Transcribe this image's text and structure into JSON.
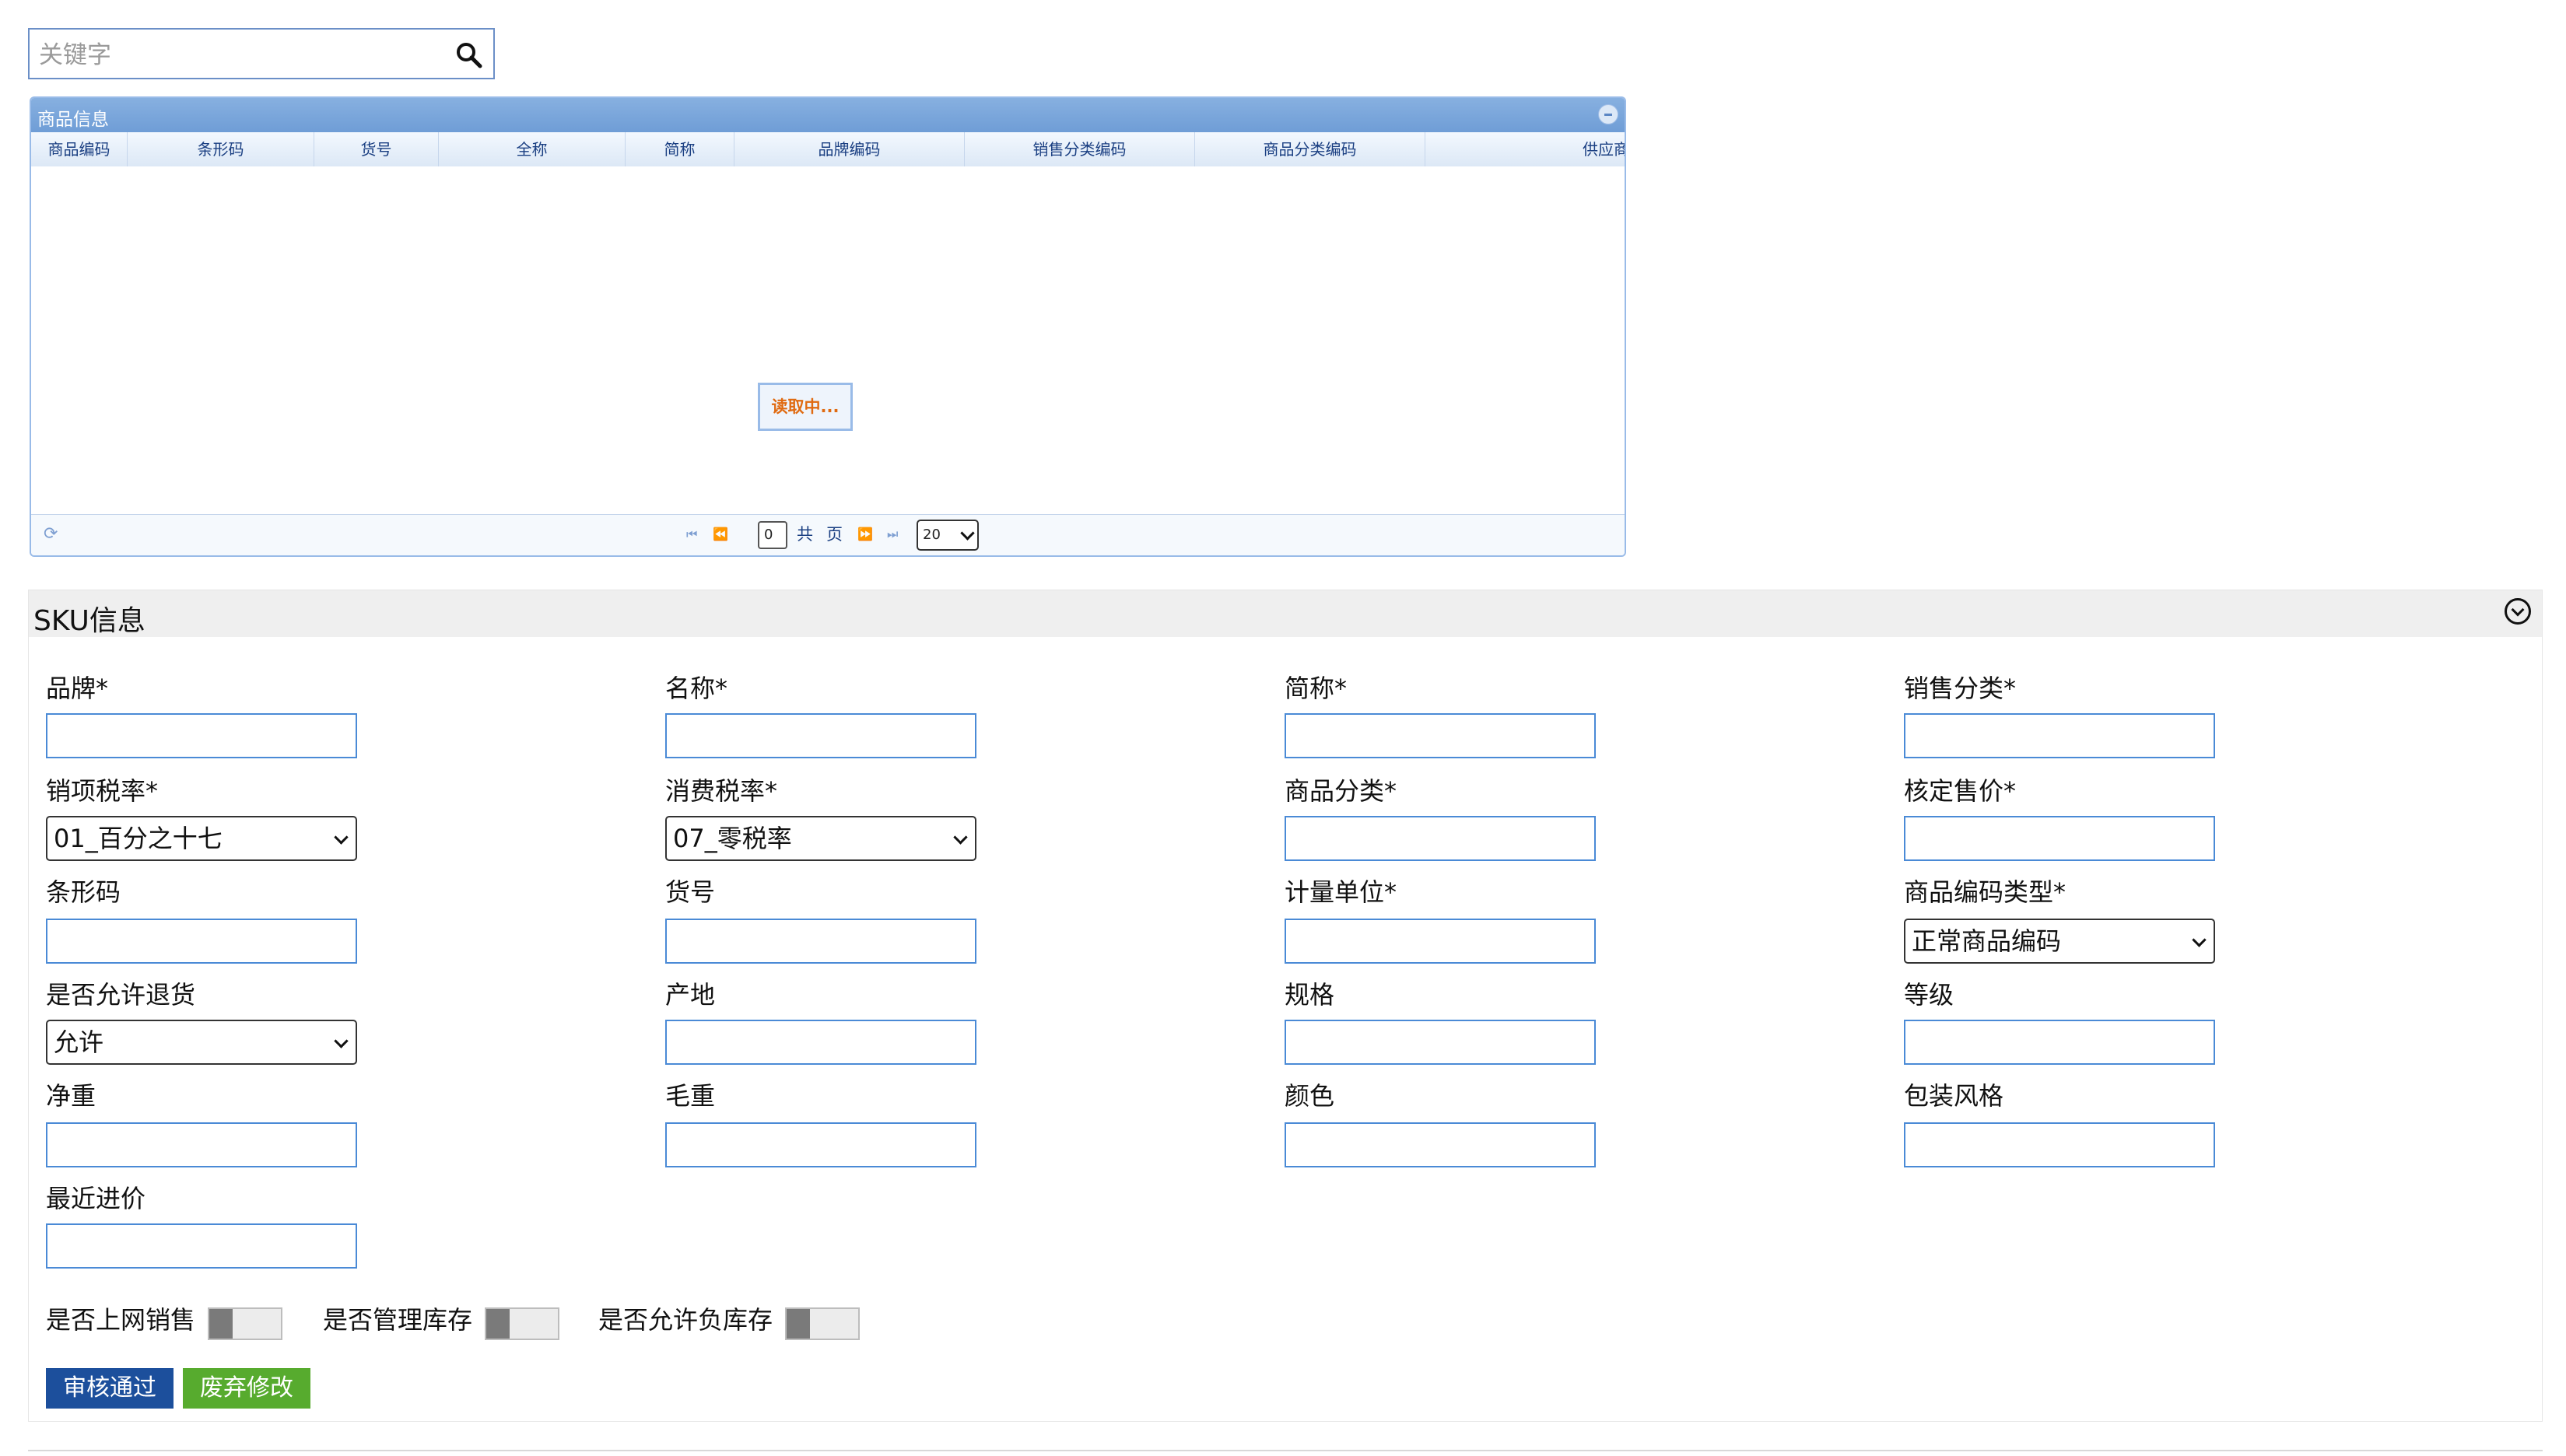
{
  "search": {
    "placeholder": "关键字"
  },
  "grid": {
    "title": "商品信息",
    "columns": [
      "商品编码",
      "条形码",
      "货号",
      "全称",
      "简称",
      "品牌编码",
      "销售分类编码",
      "商品分类编码",
      "供应商"
    ],
    "loading_text": "读取中...",
    "pager": {
      "current_page": "0",
      "total_label": "共",
      "page_label": "页",
      "page_size": "20"
    }
  },
  "sku": {
    "title": "SKU信息",
    "fields": {
      "brand": "品牌*",
      "name": "名称*",
      "short_name": "简称*",
      "sales_category": "销售分类*",
      "sales_tax_rate": "销项税率*",
      "consumption_tax_rate": "消费税率*",
      "product_category": "商品分类*",
      "approved_price": "核定售价*",
      "barcode": "条形码",
      "item_no": "货号",
      "unit": "计量单位*",
      "code_type": "商品编码类型*",
      "allow_return": "是否允许退货",
      "origin": "产地",
      "spec": "规格",
      "grade": "等级",
      "net_weight": "净重",
      "gross_weight": "毛重",
      "color": "颜色",
      "package_style": "包装风格",
      "latest_purchase_price": "最近进价"
    },
    "selects": {
      "sales_tax_rate": "01_百分之十七",
      "consumption_tax_rate": "07_零税率",
      "code_type": "正常商品编码",
      "allow_return": "允许"
    },
    "toggles": {
      "online_sale": "是否上网销售",
      "manage_stock": "是否管理库存",
      "allow_negative_stock": "是否允许负库存"
    },
    "buttons": {
      "approve": "审核通过",
      "discard": "废弃修改"
    }
  },
  "colors": {
    "approve_button": "#1c4f9c",
    "discard_button": "#57ab2e",
    "grid_title_bar": "#87b0e0",
    "input_border": "#4a8ad6",
    "loading_text": "#e06a10"
  }
}
